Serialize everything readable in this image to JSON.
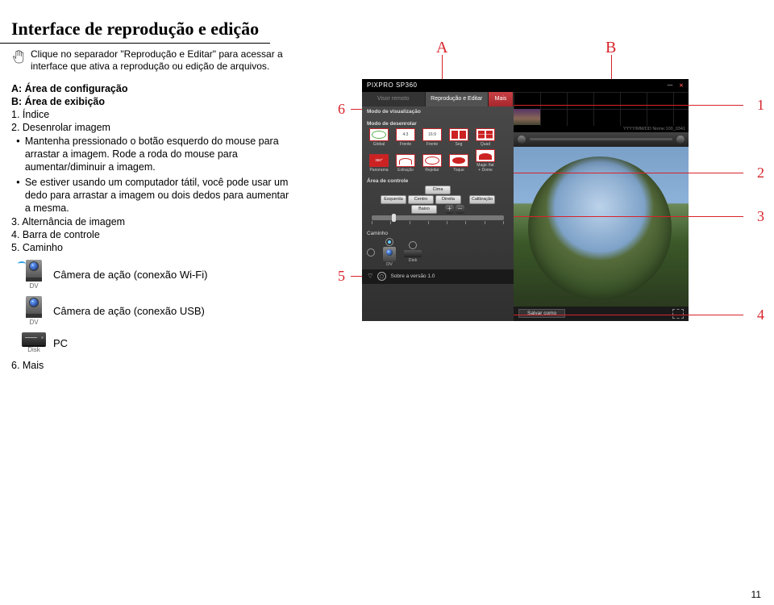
{
  "page_title": "Interface de reprodução e edição",
  "intro": "Clique no separador \"Reprodução e Editar\" para acessar a interface que ativa a reprodução ou edição de arquivos.",
  "legend": {
    "a": "A: Área de configuração",
    "b": "B: Área de exibição",
    "item1": "1. Índice",
    "item2": "2. Desenrolar imagem",
    "bullet1": "Mantenha pressionado o botão esquerdo do mouse para arrastar a imagem. Rode a roda do mouse para aumentar/diminuir a imagem.",
    "bullet2": "Se estiver usando um computador tátil, você pode usar um dedo para arrastar a imagem ou dois dedos para aumentar a mesma.",
    "item3": "3. Alternância de imagem",
    "item4": "4. Barra de controle",
    "item5": "5. Caminho",
    "item6": "6. Mais"
  },
  "legend_icons": {
    "wifi": "Câmera de ação (conexão Wi-Fi)",
    "usb": "Câmera de ação (conexão USB)",
    "pc": "PC",
    "dv_label": "DV",
    "disk_label": "Disk"
  },
  "labels": {
    "A": "A",
    "B": "B"
  },
  "callouts": {
    "1": "1",
    "2": "2",
    "3": "3",
    "4": "4",
    "5": "5",
    "6": "6"
  },
  "app": {
    "logo": "PIXPRO SP360",
    "tabs": {
      "remote": "Visor remoto",
      "play": "Reprodução e Editar",
      "more": "Mais"
    },
    "sections": {
      "view_mode": "Modo de visualização",
      "unfold_mode": "Modo de desenrolar",
      "control_area": "Área de controle",
      "path": "Caminho"
    },
    "unfold": {
      "global": "Global",
      "frente": "Frente",
      "seg": "Seg",
      "quad": "Quad",
      "panorama": "Panorama",
      "extracao": "Extração",
      "rejeitar": "Rejeitar",
      "toque": "Toque",
      "magic": "Magic flat\n+ Dome"
    },
    "ctrl": {
      "cima": "Cima",
      "baixo": "Baixo",
      "esquerda": "Esquerda",
      "centro": "Centro",
      "direita": "Direita",
      "calibracao": "Calibração"
    },
    "path_items": {
      "dv": "DV",
      "disk": "Disk"
    },
    "bottom": {
      "about": "Sobre a versão 1.0",
      "save": "Salvar como"
    },
    "meta": "YYYY/MM/DD Nome:100_0341"
  },
  "page_number": "11"
}
